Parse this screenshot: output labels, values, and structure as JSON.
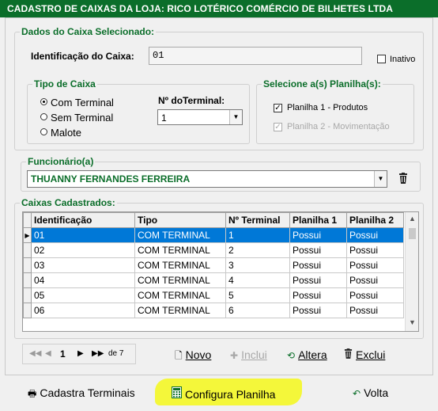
{
  "window": {
    "title": "CADASTRO DE CAIXAS DA LOJA: RICO LOTÉRICO COMÉRCIO DE BILHETES LTDA"
  },
  "dados": {
    "legend": "Dados do Caixa Selecionado:",
    "identificacao_label": "Identificação do Caixa:",
    "identificacao_value": "01",
    "inativo_label": "Inativo",
    "inativo_checked": false
  },
  "tipo": {
    "legend": "Tipo de Caixa",
    "options": [
      "Com Terminal",
      "Sem Terminal",
      "Malote"
    ],
    "selected": "Com Terminal",
    "terminal_label": "Nº doTerminal:",
    "terminal_value": "1"
  },
  "planilhas": {
    "legend": "Selecione a(s) Planilha(s):",
    "items": [
      {
        "label": "Planilha 1 - Produtos",
        "checked": true,
        "enabled": true
      },
      {
        "label": "Planilha 2 - Movimentação",
        "checked": true,
        "enabled": false
      }
    ]
  },
  "funcionario": {
    "legend": "Funcionário(a)",
    "value": "THUANNY FERNANDES FERREIRA"
  },
  "caixas": {
    "legend": "Caixas Cadastrados:",
    "columns": [
      "Identificação",
      "Tipo",
      "Nº Terminal",
      "Planilha 1",
      "Planilha 2"
    ],
    "rows": [
      [
        "01",
        "COM TERMINAL",
        "1",
        "Possui",
        "Possui"
      ],
      [
        "02",
        "COM TERMINAL",
        "2",
        "Possui",
        "Possui"
      ],
      [
        "03",
        "COM TERMINAL",
        "3",
        "Possui",
        "Possui"
      ],
      [
        "04",
        "COM TERMINAL",
        "4",
        "Possui",
        "Possui"
      ],
      [
        "05",
        "COM TERMINAL",
        "5",
        "Possui",
        "Possui"
      ],
      [
        "06",
        "COM TERMINAL",
        "6",
        "Possui",
        "Possui"
      ]
    ],
    "selected_row": 0
  },
  "navigator": {
    "page": "1",
    "of_label": "de 7"
  },
  "actions": {
    "novo": "Novo",
    "incluir": "Inclui",
    "alterar": "Altera",
    "excluir": "Exclui"
  },
  "footer": {
    "cadastra_terminais": "Cadastra Terminais",
    "configura_planilha": "Configura Planilha",
    "volta": "Volta"
  },
  "colors": {
    "title_bg": "#0b6e2a",
    "accent_green": "#0b6e2a",
    "selection_blue": "#0078d7",
    "highlight_yellow": "#f4f73a"
  }
}
